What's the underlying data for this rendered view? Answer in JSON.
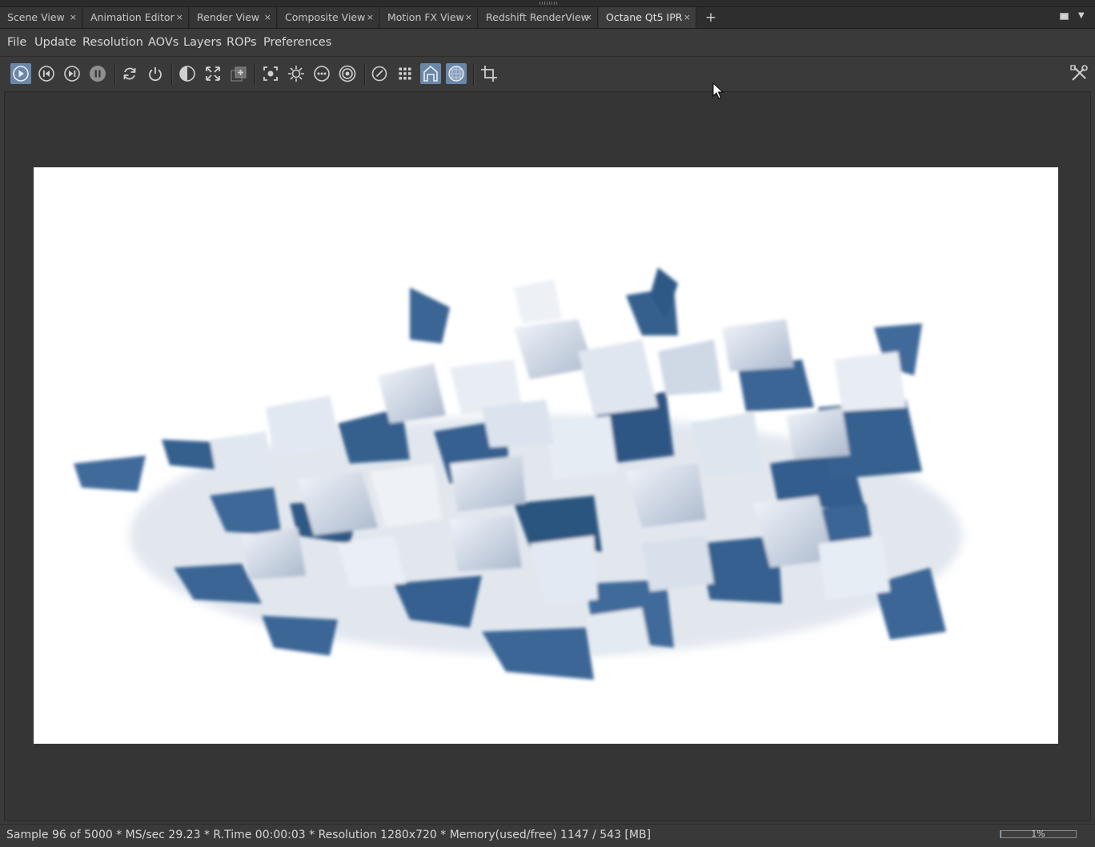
{
  "tabs": [
    {
      "label": "Scene View",
      "close": "×"
    },
    {
      "label": "Animation Editor",
      "close": "×"
    },
    {
      "label": "Render View",
      "close": "×"
    },
    {
      "label": "Composite View",
      "close": "×"
    },
    {
      "label": "Motion FX View",
      "close": "×"
    },
    {
      "label": "Redshift RenderView",
      "close": "×"
    },
    {
      "label": "Octane Qt5 IPR",
      "close": "×",
      "active": true
    }
  ],
  "tab_add": "+",
  "menu": [
    "File",
    "Update",
    "Resolution",
    "AOVs",
    "Layers",
    "ROPs",
    "Preferences"
  ],
  "toolbar_icons": [
    {
      "name": "play-render-icon",
      "active": true
    },
    {
      "name": "step-back-icon"
    },
    {
      "name": "step-forward-icon"
    },
    {
      "name": "pause-icon"
    },
    {
      "name": "refresh-icon"
    },
    {
      "name": "power-icon"
    },
    {
      "name": "contrast-icon"
    },
    {
      "name": "fit-expand-icon"
    },
    {
      "name": "add-region-icon"
    },
    {
      "name": "focus-picker-icon"
    },
    {
      "name": "light-sun-icon"
    },
    {
      "name": "more-options-icon"
    },
    {
      "name": "target-icon"
    },
    {
      "name": "speed-dial-icon"
    },
    {
      "name": "grid-icon"
    },
    {
      "name": "house-icon",
      "active": true
    },
    {
      "name": "sphere-icon",
      "active": true
    },
    {
      "name": "crop-icon"
    },
    {
      "name": "settings-tools-icon"
    }
  ],
  "status": {
    "text": "Sample 96 of 5000 * MS/sec 29.23 * R.Time 00:00:03 * Resolution 1280x720 * Memory(used/free) 1147 / 543 [MB]",
    "progress_label": "1%",
    "progress_value": 0.01
  },
  "colors": {
    "accent": "#6b87a8",
    "shard_blue": "#3f6a9a",
    "shard_light": "#dfe6f0"
  }
}
